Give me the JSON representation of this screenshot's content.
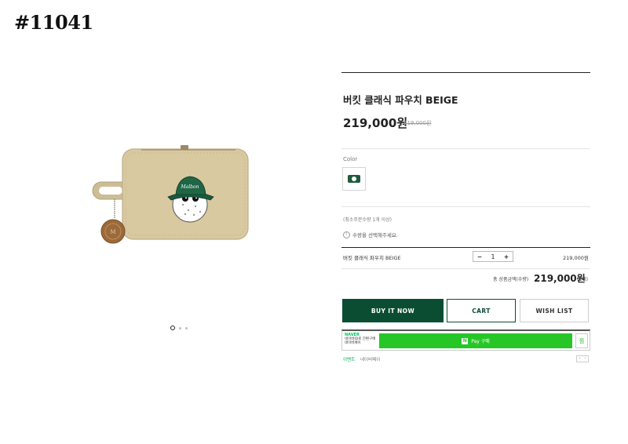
{
  "sku": "#11041",
  "product": {
    "title": "버킷 클래식 파우치 BEIGE",
    "price": "219,000원",
    "original_price": "219,000원",
    "hat_text": "Malbon"
  },
  "color_section": {
    "label": "Color"
  },
  "quantity": {
    "min_notice": "(최소주문수량 1개 이상)",
    "select_notice": "수량을 선택해주세요."
  },
  "option_row": {
    "name": "버킷 클래식 파우치 BEIGE",
    "minus": "−",
    "qty": "1",
    "plus": "+",
    "price": "219,000원"
  },
  "total": {
    "label": "총 상품금액(수량)",
    "price": "219,000원",
    "count": "(1개)"
  },
  "buttons": {
    "buy_now": "BUY IT NOW",
    "cart": "CART",
    "wish_list": "WISH LIST"
  },
  "naver_pay": {
    "brand": "NAVER",
    "sub": "네이버ID로 간편구매 네이버페이",
    "n_logo": "N",
    "pay_label": "Pay 구매",
    "wish_icon": "찜",
    "event_link": "이벤트",
    "event_text": "네이버페이",
    "prev": "‹",
    "next": "›"
  },
  "gallery": {
    "active_dot": 1,
    "dot_count": 3
  },
  "colors": {
    "brand_green": "#0b4d33",
    "naver_green": "#27c627",
    "pouch_beige": "#d9c9a1"
  }
}
